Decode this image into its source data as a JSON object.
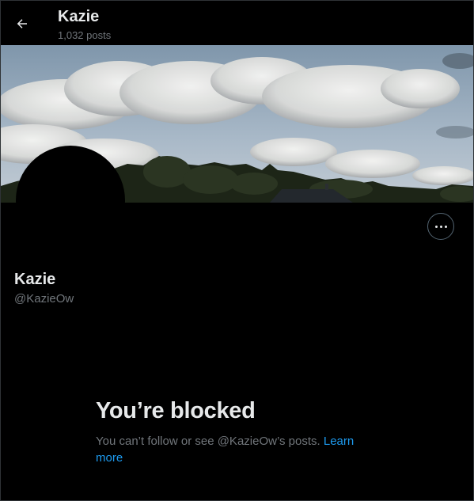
{
  "header": {
    "name": "Kazie",
    "posts": "1,032 posts",
    "back_icon": "arrow-left-icon"
  },
  "profile": {
    "display_name": "Kazie",
    "handle": "@KazieOw",
    "more_icon": "more-horizontal-icon"
  },
  "blocked": {
    "title": "You’re blocked",
    "message": "You can’t follow or see @KazieOw’s posts. ",
    "link": "Learn more"
  },
  "colors": {
    "background": "#000000",
    "text_primary": "#e7e9ea",
    "text_secondary": "#71767b",
    "link": "#1d9bf0"
  }
}
